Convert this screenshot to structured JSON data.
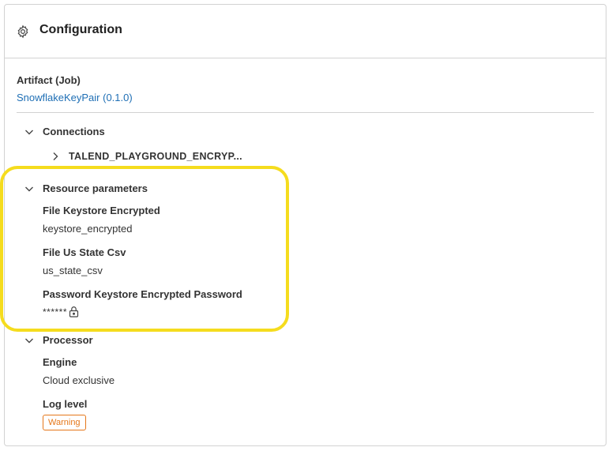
{
  "header": {
    "title": "Configuration",
    "icon": "gear-icon"
  },
  "artifact": {
    "label": "Artifact (Job)",
    "link_text": "SnowflakeKeyPair (0.1.0)",
    "link_color": "#1f6fb5"
  },
  "connections": {
    "label": "Connections",
    "expanded": true,
    "items": [
      {
        "label": "TALEND_PLAYGROUND_ENCRYP...",
        "expanded": false
      }
    ]
  },
  "resource_parameters": {
    "label": "Resource parameters",
    "expanded": true,
    "fields": [
      {
        "label": "File Keystore Encrypted",
        "value": "keystore_encrypted"
      },
      {
        "label": "File Us State Csv",
        "value": "us_state_csv"
      },
      {
        "label": "Password Keystore Encrypted Password",
        "value": "******",
        "icon": "lock-icon"
      }
    ],
    "highlight_color": "#f5dc1e"
  },
  "processor": {
    "label": "Processor",
    "expanded": true,
    "fields": [
      {
        "label": "Engine",
        "value": "Cloud exclusive"
      },
      {
        "label": "Log level",
        "badge": "Warning",
        "badge_color": "#e5771a"
      }
    ]
  }
}
